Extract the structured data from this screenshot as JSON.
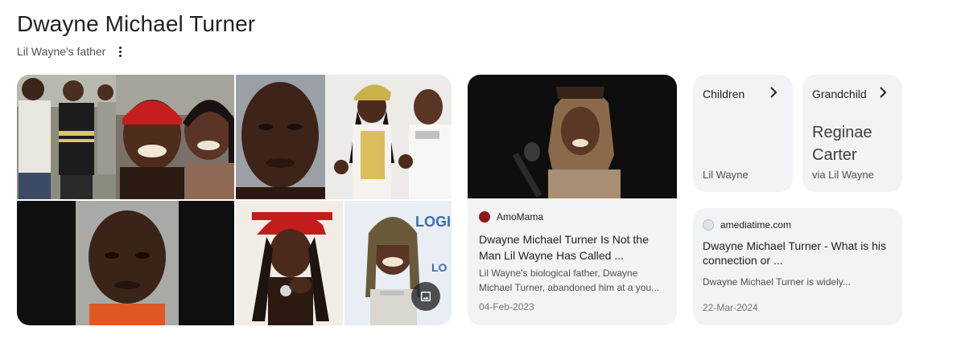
{
  "header": {
    "title": "Dwayne Michael Turner",
    "subtitle": "Lil Wayne's father"
  },
  "gallery": {
    "tiles": [
      {
        "name": "image-family-group"
      },
      {
        "name": "image-man-red-bandana-with-woman"
      },
      {
        "name": "image-mugshot-closeup"
      },
      {
        "name": "image-lil-wayne-and-birdman"
      },
      {
        "name": "image-mugshot-dark-background"
      },
      {
        "name": "image-lil-wayne-red-cap"
      },
      {
        "name": "image-lil-wayne-smiling"
      }
    ],
    "more_images_icon": "image-gallery-icon"
  },
  "article_card": {
    "source": "AmoMama",
    "headline_line1": "Dwayne Michael Turner Is Not the",
    "headline_line2": "Man Lil Wayne Has Called ...",
    "snippet_line1": "Lil Wayne's biological father, Dwayne",
    "snippet_line2": "Michael Turner, abandoned him at a you...",
    "date": "04-Feb-2023"
  },
  "children_card": {
    "label": "Children",
    "value": "Lil Wayne"
  },
  "grandchild_card": {
    "label": "Grandchild",
    "name_line1": "Reginae",
    "name_line2": "Carter",
    "via": "via Lil Wayne"
  },
  "article_card2": {
    "source": "amediatime.com",
    "headline_line1": "Dwayne Michael Turner - What is his",
    "headline_line2": "connection or ...",
    "snippet": "Dwayne Michael Turner is widely...",
    "date": "22-Mar-2024"
  },
  "colors": {
    "card_bg": "#f1f3f4",
    "title_text": "#202124",
    "secondary_text": "#4d5156",
    "date_text": "#70757a",
    "amomama_favicon": "#8b1a1a"
  }
}
